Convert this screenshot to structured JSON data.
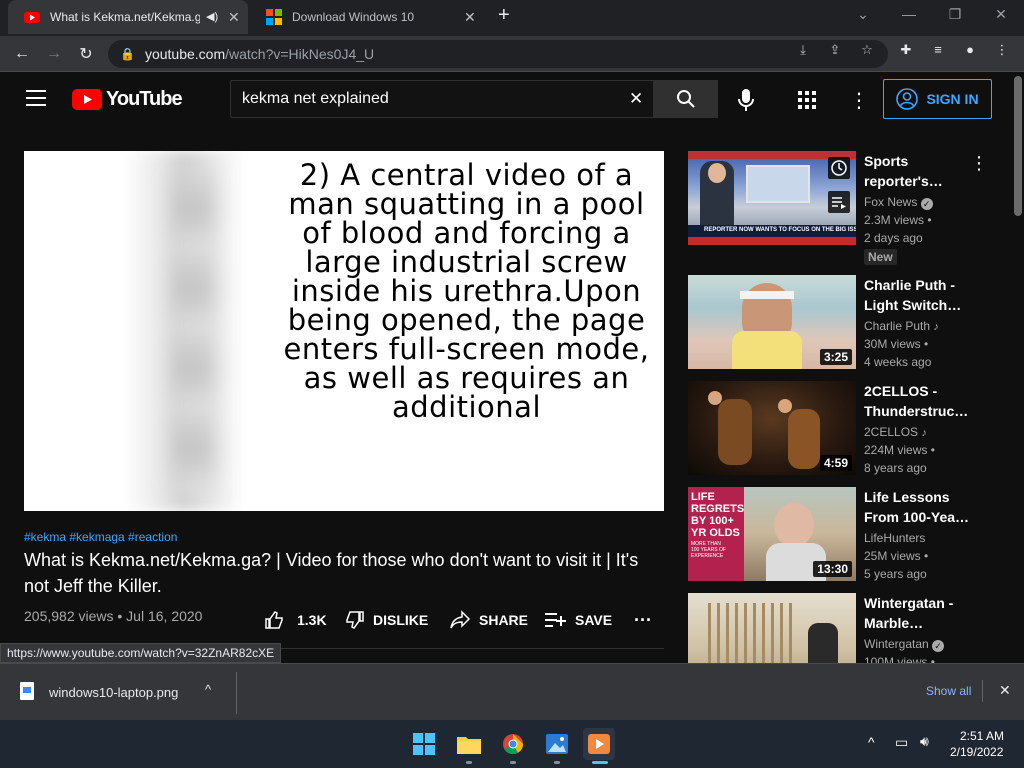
{
  "browser": {
    "tabs": [
      {
        "title": "What is Kekma.net/Kekma.ga",
        "active": true
      },
      {
        "title": "Download Windows 10",
        "active": false
      }
    ],
    "new_tab": "+",
    "url_host": "youtube.com",
    "url_path": "/watch?v=HikNes0J4_U"
  },
  "youtube": {
    "logo_text": "YouTube",
    "search_value": "kekma net explained",
    "signin_label": "SIGN IN"
  },
  "video": {
    "caption": "2) A central video of a man squatting in a pool of blood and forcing a large industrial screw inside his urethra.Upon being opened, the page enters full-screen mode, as well as requires an additional",
    "hashtags": "#kekma #kekmaga #reaction",
    "title": "What is Kekma.net/Kekma.ga? | Video for those who don't want to visit it | It's not Jeff the Killer.",
    "stats": "205,982 views • Jul 16, 2020",
    "likes": "1.3K",
    "dislike_label": "DISLIKE",
    "share_label": "SHARE",
    "save_label": "SAVE"
  },
  "status_url": "https://www.youtube.com/watch?v=32ZnAR82cXE",
  "recommendations": [
    {
      "title": "Sports reporter's…",
      "channel": "Fox News",
      "verified": true,
      "views": "2.3M views •",
      "age": "2 days ago",
      "badge": "New",
      "duration": ""
    },
    {
      "title": "Charlie Puth - Light Switch…",
      "channel": "Charlie Puth",
      "music": true,
      "views": "30M views •",
      "age": "4 weeks ago",
      "duration": "3:25"
    },
    {
      "title": "2CELLOS - Thunderstruc…",
      "channel": "2CELLOS",
      "music": true,
      "views": "224M views •",
      "age": "8 years ago",
      "duration": "4:59"
    },
    {
      "title": "Life Lessons From 100-Yea…",
      "channel": "LifeHunters",
      "views": "25M views •",
      "age": "5 years ago",
      "duration": "13:30"
    },
    {
      "title": "Wintergatan - Marble…",
      "channel": "Wintergatan",
      "verified": true,
      "views": "100M views •",
      "age": "",
      "duration": ""
    }
  ],
  "thumb_texts": {
    "fox_banner": "REPORTER NOW WANTS TO FOCUS ON THE BIG ISSUES",
    "life_lines": [
      "LIFE",
      "REGRETS",
      "BY 100+",
      "YR OLDS",
      "MORE THAN",
      "100 YEARS OF",
      "EXPERIENCE"
    ]
  },
  "download": {
    "filename": "windows10-laptop.png",
    "show_all": "Show all"
  },
  "taskbar": {
    "time": "2:51 AM",
    "date": "2/19/2022"
  },
  "colors": {
    "accent_blue": "#3ea6ff",
    "yt_red": "#ff0000",
    "bg": "#0f0f0f"
  }
}
